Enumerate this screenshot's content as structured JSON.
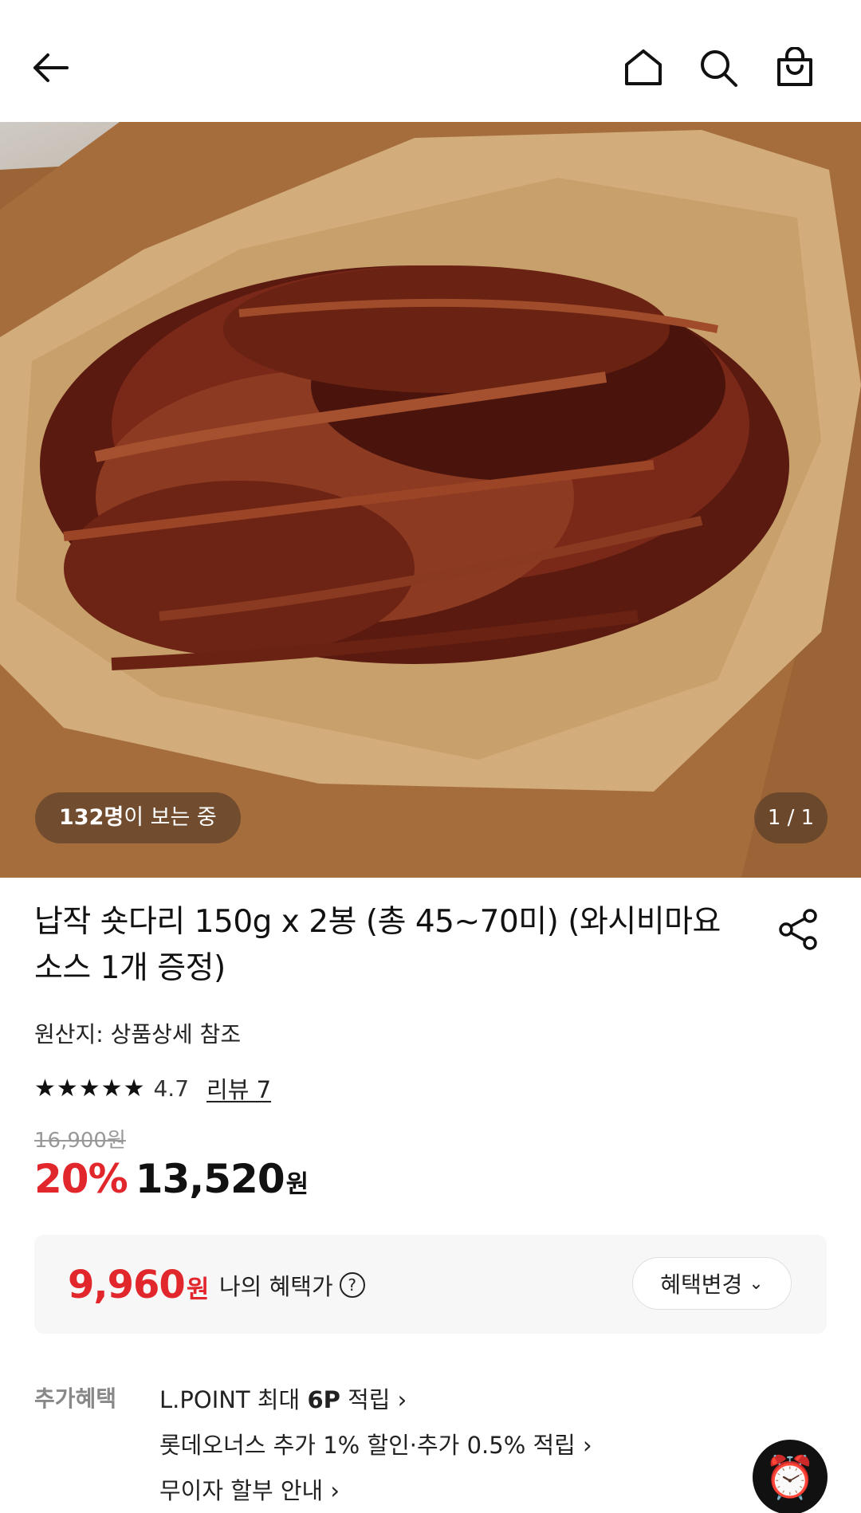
{
  "header": {
    "icons": [
      "arrow-left-icon",
      "home-icon",
      "search-icon",
      "shopping-bag-icon"
    ]
  },
  "hero": {
    "viewers_count": "132명",
    "viewers_suffix": "이 보는 중",
    "image_counter": "1 / 1"
  },
  "product": {
    "title_line1": "납작 숏다리 150g x 2봉 (총 45~70미) (와시비마요",
    "title_line2": "소스 1개 증정)",
    "origin": "원산지: 상품상세 참조",
    "stars": "★★★★★",
    "rating": "4.7",
    "rating_fraction": 0.94,
    "reviews": "리뷰 7",
    "original_price": "16,900원",
    "discount": "20%",
    "sale_price": "13,520",
    "currency": "원"
  },
  "benefit": {
    "price": "9,960",
    "currency": "원",
    "label": "나의 혜택가",
    "help": "?",
    "change_button": "혜택변경",
    "chevron": "⌄"
  },
  "extra": {
    "label": "추가혜택",
    "item1_pre": "L.POINT 최대 ",
    "item1_bold": "6P",
    "item1_post": " 적립 ›",
    "item2": "롯데오너스 추가 1% 할인·추가 0.5% 적립 ›",
    "item3": "무이자 할부 안내 ›"
  },
  "floating": {
    "alarm_icon": "⏰"
  },
  "colors": {
    "accent_red": "#e1262c",
    "text_dark": "#111111",
    "muted": "#999999"
  }
}
